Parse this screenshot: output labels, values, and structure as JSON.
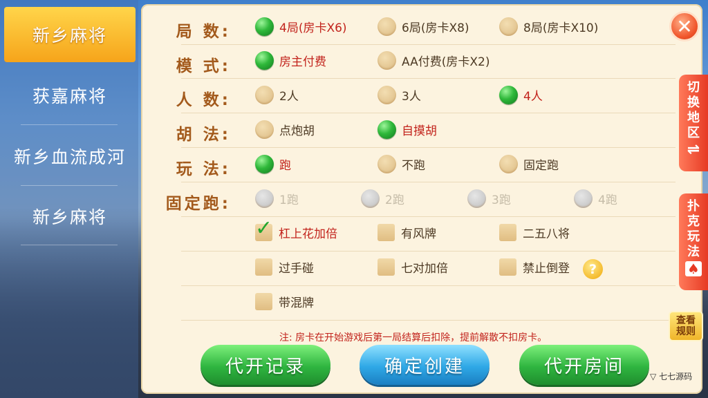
{
  "sidebar": {
    "items": [
      {
        "label": "新乡麻将",
        "active": true
      },
      {
        "label": "获嘉麻将",
        "active": false
      },
      {
        "label": "新乡血流成河",
        "active": false
      },
      {
        "label": "新乡麻将",
        "active": false
      }
    ]
  },
  "rows": {
    "rounds": {
      "label": "局 数:",
      "options": [
        "4局(房卡X6)",
        "6局(房卡X8)",
        "8局(房卡X10)"
      ],
      "selected": 0
    },
    "mode": {
      "label": "模 式:",
      "options": [
        "房主付费",
        "AA付费(房卡X2)"
      ],
      "selected": 0
    },
    "players": {
      "label": "人 数:",
      "options": [
        "2人",
        "3人",
        "4人"
      ],
      "selected": 2
    },
    "hu": {
      "label": "胡 法:",
      "options": [
        "点炮胡",
        "自摸胡"
      ],
      "selected": 1
    },
    "play": {
      "label": "玩 法:",
      "options": [
        "跑",
        "不跑",
        "固定跑"
      ],
      "selected": 0
    },
    "fixed_run": {
      "label": "固定跑:",
      "options": [
        "1跑",
        "2跑",
        "3跑",
        "4跑"
      ],
      "disabled": true
    }
  },
  "checks": [
    {
      "label": "杠上花加倍",
      "checked": true
    },
    {
      "label": "有风牌",
      "checked": false
    },
    {
      "label": "二五八将",
      "checked": false
    },
    {
      "label": "过手碰",
      "checked": false
    },
    {
      "label": "七对加倍",
      "checked": false
    },
    {
      "label": "禁止倒登",
      "checked": false
    },
    {
      "label": "带混牌",
      "checked": false
    }
  ],
  "help_icon": "?",
  "note": "注: 房卡在开始游戏后第一局结算后扣除，提前解散不扣房卡。",
  "buttons": {
    "proxy_record": "代开记录",
    "confirm_create": "确定创建",
    "proxy_room": "代开房间"
  },
  "close_icon": "✕",
  "side_tabs": {
    "switch_region": [
      "切",
      "换",
      "地",
      "区"
    ],
    "switch_region_icon": "⇌",
    "poker_play": [
      "扑",
      "克",
      "玩",
      "法"
    ],
    "poker_icon": "♠"
  },
  "rules_btn": [
    "查看",
    "规则"
  ],
  "watermark": "七七源码",
  "colors": {
    "accent_green": "#2fb540",
    "accent_blue": "#2fa8e6",
    "selected_text": "#c2231c",
    "label": "#a35a1c"
  }
}
